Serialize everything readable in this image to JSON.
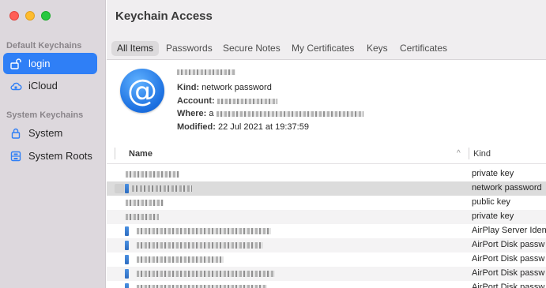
{
  "window": {
    "title": "Keychain Access"
  },
  "sidebar": {
    "sections": [
      {
        "label": "Default Keychains",
        "items": [
          {
            "label": "login",
            "icon": "lock-open-icon",
            "active": true
          },
          {
            "label": "iCloud",
            "icon": "cloud-icon",
            "active": false
          }
        ]
      },
      {
        "label": "System Keychains",
        "items": [
          {
            "label": "System",
            "icon": "lock-icon",
            "active": false
          },
          {
            "label": "System Roots",
            "icon": "cabinet-icon",
            "active": false
          }
        ]
      }
    ]
  },
  "tabs": [
    {
      "label": "All Items",
      "active": true
    },
    {
      "label": "Passwords",
      "active": false
    },
    {
      "label": "Secure Notes",
      "active": false
    },
    {
      "label": "My Certificates",
      "active": false
    },
    {
      "label": "Keys",
      "active": false
    },
    {
      "label": "Certificates",
      "active": false
    }
  ],
  "detail": {
    "icon_glyph": "@",
    "kind_label": "Kind:",
    "kind_value": "network password",
    "account_label": "Account:",
    "where_label": "Where:",
    "where_prefix": "a",
    "modified_label": "Modified:",
    "modified_value": "22 Jul 2021 at 19:37:59"
  },
  "table": {
    "columns": {
      "name": "Name",
      "sort_indicator": "^",
      "kind": "Kind"
    },
    "rows": [
      {
        "kind": "private key",
        "selected": false,
        "has_icon": false
      },
      {
        "kind": "network password",
        "selected": true,
        "has_icon": true
      },
      {
        "kind": "public key",
        "selected": false,
        "has_icon": false
      },
      {
        "kind": "private key",
        "selected": false,
        "has_icon": false
      },
      {
        "kind": "AirPlay Server Iden",
        "selected": false,
        "has_icon": true
      },
      {
        "kind": "AirPort Disk passw",
        "selected": false,
        "has_icon": true
      },
      {
        "kind": "AirPort Disk passw",
        "selected": false,
        "has_icon": true
      },
      {
        "kind": "AirPort Disk passw",
        "selected": false,
        "has_icon": true
      },
      {
        "kind": "AirPort Disk passw",
        "selected": false,
        "has_icon": true
      }
    ]
  },
  "colors": {
    "accent": "#2f7ff6",
    "sidebar_bg": "#ddd8dd"
  }
}
